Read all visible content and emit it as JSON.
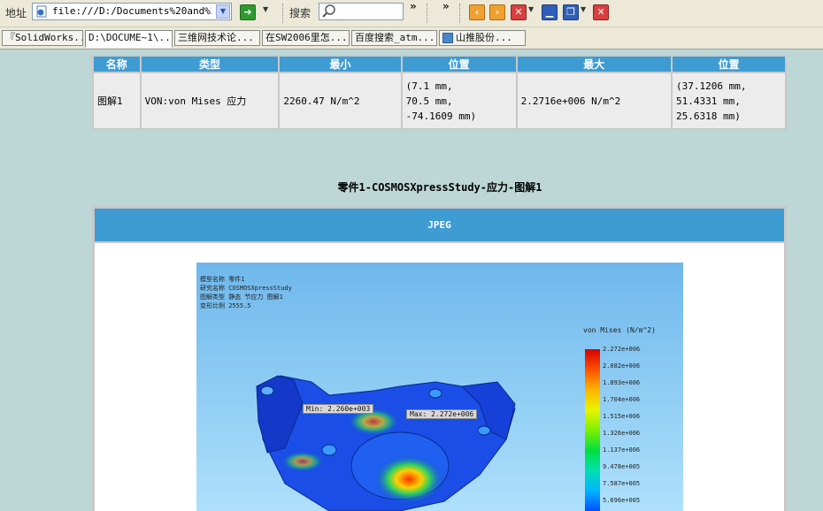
{
  "toolbar": {
    "address_label": "地址",
    "address_value": "file:///D:/Documents%20and%20Se",
    "search_label": "搜索",
    "search_value": "",
    "chevron": "»"
  },
  "tabs": [
    {
      "label": "『SolidWorks..."
    },
    {
      "label": "D:\\DOCUME~1\\..."
    },
    {
      "label": "三维网技术论..."
    },
    {
      "label": "在SW2006里怎..."
    },
    {
      "label": "百度搜索_atm..."
    },
    {
      "label": "山推股份..."
    }
  ],
  "table": {
    "headers": [
      "名称",
      "类型",
      "最小",
      "位置",
      "最大",
      "位置"
    ],
    "row": {
      "name": "图解1",
      "type": "VON:von Mises 应力",
      "min": "2260.47 N/m^2",
      "min_loc": [
        "(7.1 mm,",
        "70.5 mm,",
        "-74.1609 mm)"
      ],
      "max": "2.2716e+006 N/m^2",
      "max_loc": [
        "(37.1206 mm,",
        "51.4331 mm,",
        "25.6318 mm)"
      ]
    }
  },
  "figure": {
    "caption": "零件1-COSMOSXpressStudy-应力-图解1",
    "header": "JPEG",
    "info_lines": [
      "模型名称  零件1",
      "研究名称  COSMOSXpressStudy",
      "图解类型  静态 节应力 图解1",
      "变形比例  2555.5"
    ],
    "legend_title": "von Mises (N/m^2)",
    "ticks": [
      "2.272e+006",
      "2.082e+006",
      "1.893e+006",
      "1.704e+006",
      "1.515e+006",
      "1.326e+006",
      "1.137e+006",
      "9.478e+005",
      "7.587e+005",
      "5.696e+005"
    ],
    "min_tag": "Min: 2.260e+003",
    "max_tag": "Max: 2.272e+006"
  }
}
